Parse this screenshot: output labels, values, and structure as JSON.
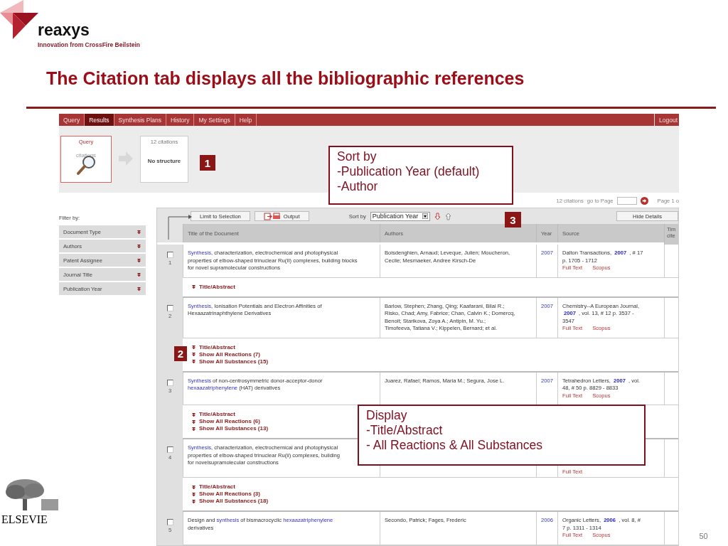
{
  "logo": {
    "name": "reaxys",
    "tagline": "Innovation from CrossFire Beilstein"
  },
  "slide_title": "The Citation tab displays all the bibliographic references",
  "nav": {
    "tabs": [
      {
        "label": "Query",
        "selected": false
      },
      {
        "label": "Results",
        "selected": true
      },
      {
        "label": "Synthesis Plans",
        "selected": false
      },
      {
        "label": "History",
        "selected": false
      },
      {
        "label": "My Settings",
        "selected": false
      },
      {
        "label": "Help",
        "selected": false
      }
    ],
    "logout": "Logout"
  },
  "query_card": {
    "title": "Query",
    "caption": "citations"
  },
  "result_card": {
    "count": "12 citations",
    "structure": "No structure"
  },
  "pager": {
    "count": "12 citations",
    "goto": "go to Page",
    "page": "Page 1 o"
  },
  "filter": {
    "title": "Filter by:",
    "items": [
      "Document Type",
      "Authors",
      "Patent Assignee",
      "Journal Title",
      "Publication Year"
    ]
  },
  "toolbar": {
    "limit": "Limit to Selection",
    "output": "Output",
    "sort_label": "Sort by",
    "sort_value": "Publication Year",
    "hide": "Hide Details"
  },
  "columns": [
    "Title of the Document",
    "Authors",
    "Year",
    "Source",
    [
      "Tim",
      "cite"
    ]
  ],
  "rows": [
    {
      "number": "1",
      "checked": false,
      "title": [
        [
          {
            "text": "Synthesis",
            "link": true
          },
          {
            "text": ", characterization, electrochemical and photophysical",
            "link": false
          }
        ],
        [
          {
            "text": "properties of elbow-shaped trinuclear Ru(II) complexes, building blocks",
            "link": false
          }
        ],
        [
          {
            "text": "for novel supramolecular constructions",
            "link": false
          }
        ]
      ],
      "authors": [
        "Boisdenghien, Arnaud; Leveque, Julien; Moucheron,",
        "Cecile; Mesmaeker, Andree Kirsch-De"
      ],
      "year": "2007",
      "source": [
        "Dalton Transactions,  **2007** ,  # 17",
        "p. 1705 - 1712"
      ],
      "links": [
        "Full Text",
        "Scopus"
      ],
      "expand": [
        "Title/Abstract"
      ]
    },
    {
      "number": "2",
      "checked": false,
      "title": [
        [
          {
            "text": "Synthesis",
            "link": true
          },
          {
            "text": ", Ionisation Potentials and Electron Affinities of",
            "link": false
          }
        ],
        [
          {
            "text": "Hexaazatrinaphthylene Derivatives",
            "link": false
          }
        ]
      ],
      "authors": [
        "Barlow, Stephen; Zhang, Qing; Kaafarani, Bilal R.;",
        "Risko, Chad; Amy, Fabrice; Chan, Calvin K.; Domercq,",
        "Benoit; Starikova, Zoya A.; Antipin, M. Yu.;",
        "Timofeeva, Tatiana V.; Kippelen, Bernard; et al."
      ],
      "year": "2007",
      "source": [
        "Chemistry--A European Journal,",
        "**2007** , vol. 13, # 12 p. 3537 -",
        "3547"
      ],
      "links": [
        "Full Text",
        "Scopus"
      ],
      "expand": [
        "Title/Abstract",
        "Show All Reactions (7)",
        "Show All Substances (15)"
      ]
    },
    {
      "number": "3",
      "checked": false,
      "title": [
        [
          {
            "text": "Synthesis",
            "link": true
          },
          {
            "text": " of non-centrosymmetric donor-acceptor-donor",
            "link": false
          }
        ],
        [
          {
            "text": "hexaazatriphenylene",
            "link": true
          },
          {
            "text": " (HAT) derivatives",
            "link": false
          }
        ]
      ],
      "authors": [
        "Juarez, Rafael; Ramos, Maria M.; Segura, Jose L."
      ],
      "year": "2007",
      "source": [
        "Tetrahedron Letters,  **2007** , vol.",
        "48, # 50 p. 8829 - 8833"
      ],
      "links": [
        "Full Text",
        "Scopus"
      ],
      "expand": [
        "Title/Abstract",
        "Show All Reactions (6)",
        "Show All Substances (13)"
      ]
    },
    {
      "number": "4",
      "checked": false,
      "title": [
        [
          {
            "text": "Synthesis",
            "link": true
          },
          {
            "text": ", characterization, electrochemical and photophysical",
            "link": false
          }
        ],
        [
          {
            "text": "properties of elbow-shaped trinuclear Ru(ii) complexes, building",
            "link": false
          }
        ],
        [
          {
            "text": "for novelsupramolecular constructions",
            "link": false
          }
        ]
      ],
      "links": [
        "Full Text"
      ],
      "expand": [
        "Title/Abstract",
        "Show All Reactions (3)",
        "Show All Substances (18)"
      ]
    },
    {
      "number": "5",
      "checked": false,
      "title": [
        [
          {
            "text": "Design and ",
            "link": false
          },
          {
            "text": "synthesis",
            "link": true
          },
          {
            "text": " of bismacrocyclic ",
            "link": false
          },
          {
            "text": "hexaazatriphenylene",
            "link": true
          }
        ],
        [
          {
            "text": "derivatives",
            "link": false
          }
        ]
      ],
      "authors": [
        "Secondo, Patrick; Fages, Frederic"
      ],
      "year": "2006",
      "source": [
        "Organic Letters,  **2006** , vol. 8, #",
        "7 p. 1311 - 1314"
      ],
      "links": [
        "Full Text",
        "Scopus"
      ]
    }
  ],
  "callouts": [
    {
      "kind": "badge",
      "text": "1"
    },
    {
      "kind": "box",
      "lines": [
        "Sort by",
        "-Publication Year (default)",
        "-Author"
      ]
    },
    {
      "kind": "badge",
      "text": "3"
    },
    {
      "kind": "badge",
      "text": "2"
    },
    {
      "kind": "box",
      "lines": [
        "Display",
        "-Title/Abstract",
        "- All Reactions & All Substances"
      ]
    }
  ],
  "publisher": "ELSEVIE",
  "page_number": "50"
}
